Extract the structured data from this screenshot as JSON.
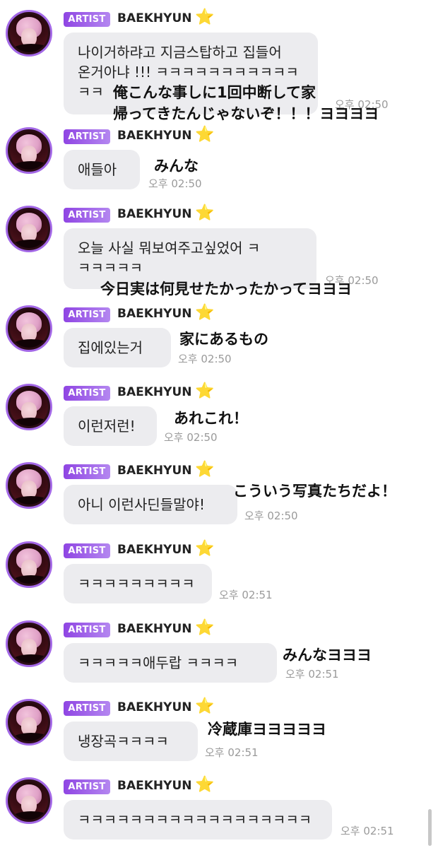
{
  "sender": {
    "badge": "ARTIST",
    "name": "BAEKHYUN",
    "star": "⭐"
  },
  "messages": [
    {
      "lines": [
        "나이거하랴고 지금스탑하고 집들어",
        "온거아냐 !!! ㅋㅋㅋㅋㅋㅋㅋㅋㅋㅋㅋ",
        "ㅋㅋ"
      ],
      "time": "오후 02:50",
      "overlay": [
        "俺こんな事しに1回中断して家",
        "帰ってきたんじゃないぞ！！！ヨヨヨヨ"
      ]
    },
    {
      "lines": [
        "애들아"
      ],
      "time": "오후 02:50",
      "overlay": [
        "みんな"
      ]
    },
    {
      "lines": [
        "오늘 사실 뭐보여주고싶었어 ㅋ",
        "ㅋㅋㅋㅋㅋ"
      ],
      "time": "오후 02:50",
      "overlay": [
        "今日実は何見せたかったかってヨヨヨ"
      ]
    },
    {
      "lines": [
        "집에있는거"
      ],
      "time": "오후 02:50",
      "overlay": [
        "家にあるもの"
      ]
    },
    {
      "lines": [
        "이런저런!"
      ],
      "time": "오후 02:50",
      "overlay": [
        "あれこれ！"
      ]
    },
    {
      "lines": [
        "아니 이런사딘들말야!"
      ],
      "time": "오후 02:50",
      "overlay": [
        "こういう写真たちだよ！"
      ]
    },
    {
      "lines": [
        "ㅋㅋㅋㅋㅋㅋㅋㅋㅋ"
      ],
      "time": "오후 02:51",
      "overlay": []
    },
    {
      "lines": [
        "ㅋㅋㅋㅋㅋ애두랍 ㅋㅋㅋㅋ"
      ],
      "time": "오후 02:51",
      "overlay": [
        "みんなヨヨヨ"
      ]
    },
    {
      "lines": [
        "냉장곡ㅋㅋㅋㅋ"
      ],
      "time": "오후 02:51",
      "overlay": [
        "冷蔵庫ヨヨヨヨヨ"
      ]
    },
    {
      "lines": [
        "ㅋㅋㅋㅋㅋㅋㅋㅋㅋㅋㅋㅋㅋㅋㅋㅋㅋㅋ"
      ],
      "time": "오후 02:51",
      "overlay": []
    }
  ],
  "colors": {
    "badge": "#9b55e8",
    "bubble": "#ececef",
    "avatar_ring": "#a368e6",
    "time": "#9a9a9a"
  }
}
